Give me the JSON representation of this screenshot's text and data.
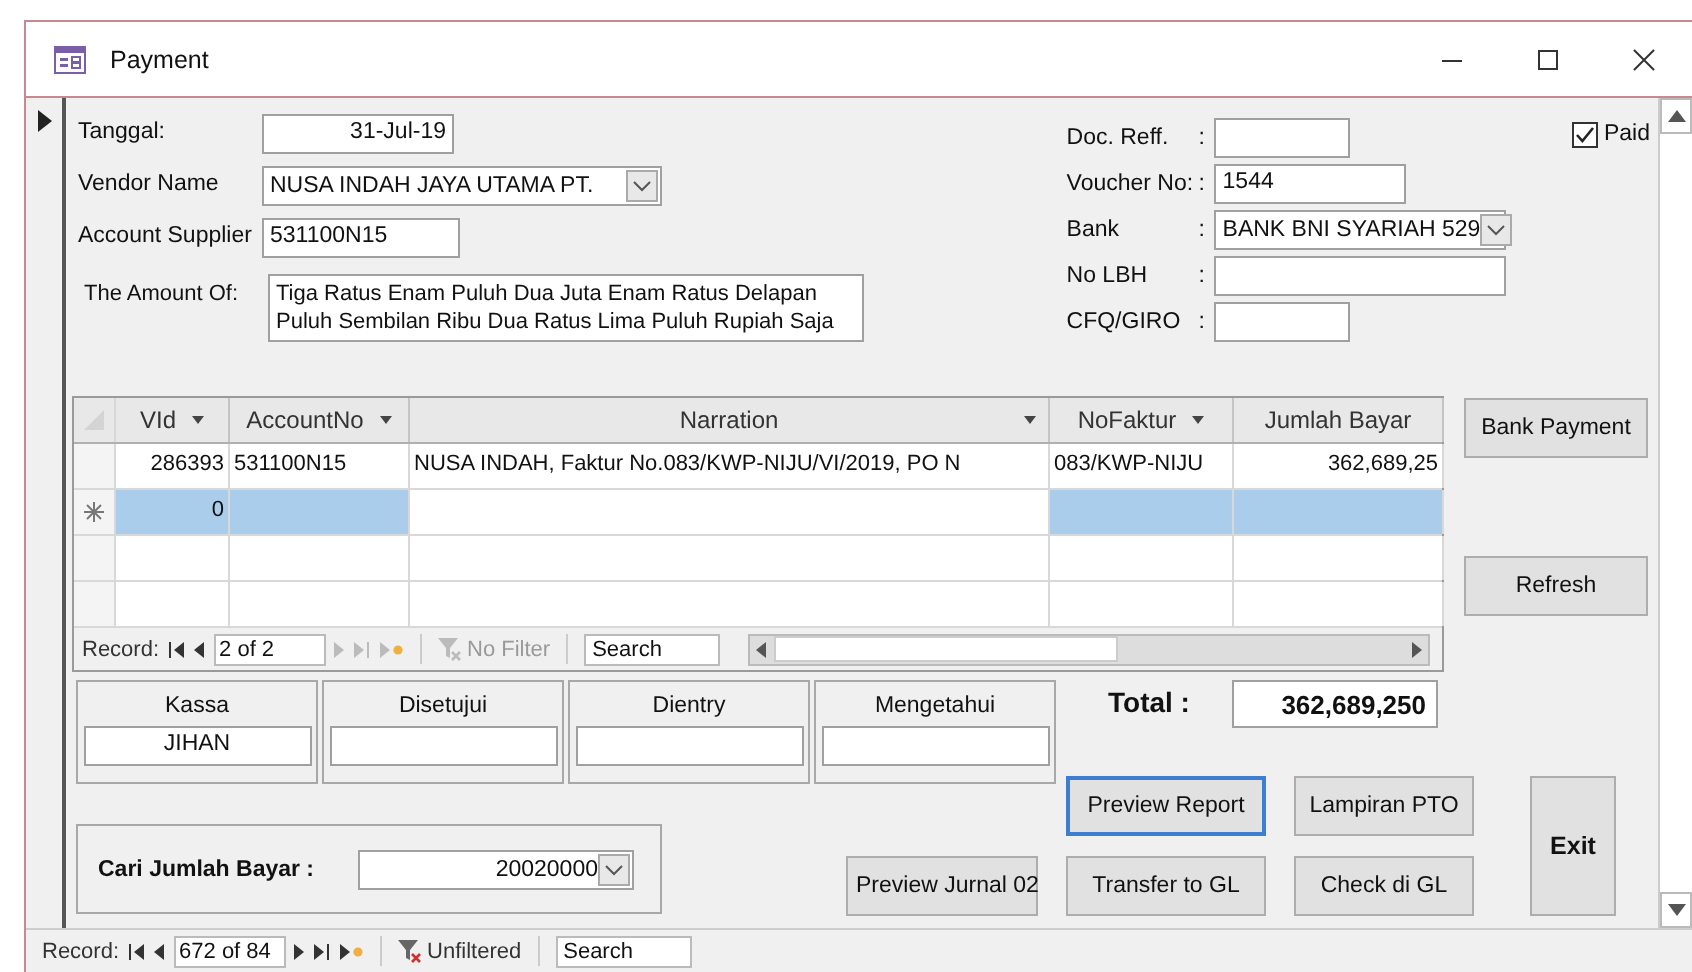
{
  "window": {
    "title": "Payment"
  },
  "left_fields": [
    {
      "label": "Tanggal:",
      "value": "31-Jul-19",
      "kind": "date"
    },
    {
      "label": "Vendor Name",
      "value": "NUSA INDAH JAYA UTAMA PT.",
      "kind": "dropdown"
    },
    {
      "label": "Account Supplier",
      "value": "531100N15",
      "kind": "text"
    },
    {
      "label": "The Amount Of:",
      "value": "Tiga Ratus Enam Puluh Dua Juta Enam Ratus Delapan Puluh Sembilan Ribu Dua Ratus Lima Puluh Rupiah Saja",
      "kind": "memo"
    }
  ],
  "right_fields": [
    {
      "label": "Doc. Reff.",
      "separator": ":",
      "kind": "short"
    },
    {
      "label": "Voucher No:",
      "separator": ":",
      "value": "1544",
      "kind": "medium"
    },
    {
      "label": "Bank",
      "separator": ":",
      "value": "BANK BNI SYARIAH 529",
      "kind": "dropdown"
    },
    {
      "label": "No LBH",
      "separator": ":",
      "kind": "long"
    },
    {
      "label": "CFQ/GIRO",
      "separator": ":",
      "kind": "short"
    }
  ],
  "paid": {
    "label": "Paid",
    "checked": true
  },
  "datasheet": {
    "columns": [
      {
        "label": "VId",
        "menu": true,
        "kind": "number"
      },
      {
        "label": "AccountNo",
        "menu": true,
        "kind": "text"
      },
      {
        "label": "Narration",
        "menu": true,
        "kind": "text"
      },
      {
        "label": "NoFaktur",
        "menu": true,
        "kind": "text"
      },
      {
        "label": "Jumlah Bayar",
        "menu": false,
        "kind": "number"
      }
    ],
    "rows": [
      {
        "kind": "record",
        "cells": [
          {
            "text": "286393",
            "highlighted": false
          },
          {
            "text": "531100N15",
            "highlighted": false
          },
          {
            "text": "NUSA INDAH, Faktur No.083/KWP-NIJU/VI/2019, PO N",
            "highlighted": false
          },
          {
            "text": "083/KWP-NIJU",
            "highlighted": false
          },
          {
            "text": "362,689,25",
            "highlighted": false
          }
        ]
      },
      {
        "kind": "new",
        "cells": [
          {
            "text": "0",
            "highlighted": true
          },
          {
            "highlighted": true
          },
          {
            "highlighted": false
          },
          {
            "highlighted": true
          },
          {
            "highlighted": true
          }
        ]
      }
    ],
    "navigation": {
      "label": "Record:",
      "position": "2 of 2",
      "next_enabled": false,
      "filter": "No Filter",
      "filter_active": false,
      "search": "Search"
    }
  },
  "side_buttons": [
    "Bank Payment",
    "Refresh"
  ],
  "approvals": [
    {
      "label": "Kassa",
      "value": "JIHAN"
    },
    {
      "label": "Disetujui"
    },
    {
      "label": "Dientry"
    },
    {
      "label": "Mengetahui"
    }
  ],
  "total": {
    "label": "Total :",
    "value": "362,689,250"
  },
  "search_amount": {
    "label": "Cari Jumlah Bayar :",
    "value": "20020000"
  },
  "action_buttons": [
    {
      "label": "Preview Jurnal 02",
      "kind": "jurnal",
      "focused": false
    },
    {
      "label": "Preview Report",
      "kind": "report",
      "focused": true
    },
    {
      "label": "Lampiran PTO",
      "kind": "lampiran",
      "focused": false
    },
    {
      "label": "Transfer to GL",
      "kind": "transfer",
      "focused": false
    },
    {
      "label": "Check di GL",
      "kind": "check",
      "focused": false
    },
    {
      "label": "Exit",
      "kind": "exit",
      "focused": false
    }
  ],
  "navigation": {
    "label": "Record:",
    "position": "672 of 84",
    "next_enabled": true,
    "filter": "Unfiltered",
    "filter_active": true,
    "search": "Search"
  }
}
